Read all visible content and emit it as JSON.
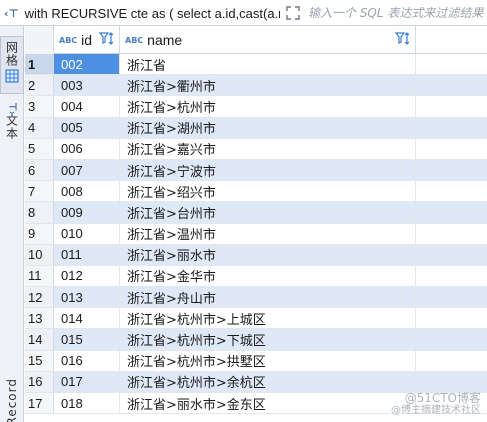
{
  "query": {
    "icon": "sql-text-icon",
    "text": "with RECURSIVE cte as ( select a.id,cast(a.na",
    "filter_placeholder": "输入一个 SQL 表达式来过滤结果"
  },
  "side_tabs": [
    {
      "label": "网格",
      "icon": "grid-icon",
      "active": true
    },
    {
      "label": "文本",
      "icon": "text-icon",
      "active": false
    },
    {
      "label": "Record",
      "icon": "",
      "active": false
    }
  ],
  "columns": [
    {
      "type_badge": "ABC",
      "name": "id"
    },
    {
      "type_badge": "ABC",
      "name": "name"
    }
  ],
  "rows": [
    {
      "n": "1",
      "id": "002",
      "name": "浙江省"
    },
    {
      "n": "2",
      "id": "003",
      "name": "浙江省>衢州市"
    },
    {
      "n": "3",
      "id": "004",
      "name": "浙江省>杭州市"
    },
    {
      "n": "4",
      "id": "005",
      "name": "浙江省>湖州市"
    },
    {
      "n": "5",
      "id": "006",
      "name": "浙江省>嘉兴市"
    },
    {
      "n": "6",
      "id": "007",
      "name": "浙江省>宁波市"
    },
    {
      "n": "7",
      "id": "008",
      "name": "浙江省>绍兴市"
    },
    {
      "n": "8",
      "id": "009",
      "name": "浙江省>台州市"
    },
    {
      "n": "9",
      "id": "010",
      "name": "浙江省>温州市"
    },
    {
      "n": "10",
      "id": "011",
      "name": "浙江省>丽水市"
    },
    {
      "n": "11",
      "id": "012",
      "name": "浙江省>金华市"
    },
    {
      "n": "12",
      "id": "013",
      "name": "浙江省>舟山市"
    },
    {
      "n": "13",
      "id": "014",
      "name": "浙江省>杭州市>上城区"
    },
    {
      "n": "14",
      "id": "015",
      "name": "浙江省>杭州市>下城区"
    },
    {
      "n": "15",
      "id": "016",
      "name": "浙江省>杭州市>拱墅区"
    },
    {
      "n": "16",
      "id": "017",
      "name": "浙江省>杭州市>余杭区"
    },
    {
      "n": "17",
      "id": "018",
      "name": "浙江省>丽水市>金东区"
    }
  ],
  "watermark": {
    "line1": "@51CTO博客",
    "line2": "@博主摘建技术社区"
  },
  "colors": {
    "selected_cell": "#4d8fe0",
    "alt_row": "#dfe8f7",
    "accent": "#3a6fb0"
  }
}
